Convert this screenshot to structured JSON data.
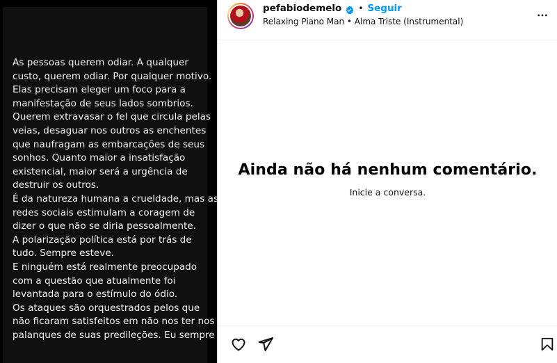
{
  "post": {
    "lines": [
      "As pessoas querem odiar. A qualquer",
      "custo, querem odiar. Por qualquer motivo.",
      "Elas precisam eleger um foco para a",
      "manifestação de seus lados sombrios.",
      "Querem extravasar o fel que circula pelas",
      "veias, desaguar nos outros as enchentes",
      "que naufragam as embarcações de seus",
      "sonhos. Quanto maior a insatisfação",
      "existencial, maior será a urgência de",
      "destruir os outros.",
      "É da natureza humana a crueldade, mas as",
      "redes sociais estimulam a coragem de",
      "dizer o que não se diria pessoalmente.",
      "A polarização política está por trás de",
      "tudo. Sempre esteve.",
      "E ninguém está realmente preocupado",
      "com a questão que atualmente foi",
      "levantada para o estímulo do ódio.",
      "Os ataques são orquestrados pelos que",
      "não ficaram satisfeitos em não nos ter nos",
      "palanques de suas predileções. Eu sempre"
    ]
  },
  "header": {
    "username": "pefabiodemelo",
    "separator": "•",
    "follow_label": "Seguir",
    "song": "Relaxing Piano Man • Alma Triste (Instrumental)",
    "verified_icon": "verified-badge-icon",
    "more_icon": "more-options-icon"
  },
  "comments": {
    "empty_title": "Ainda não há nenhum comentário.",
    "empty_subtitle": "Inicie a conversa."
  },
  "actions": {
    "like_icon": "heart-icon",
    "share_icon": "share-icon",
    "save_icon": "bookmark-icon"
  },
  "colors": {
    "accent": "#0095f6",
    "text": "#000000",
    "media_bg": "#101010"
  }
}
